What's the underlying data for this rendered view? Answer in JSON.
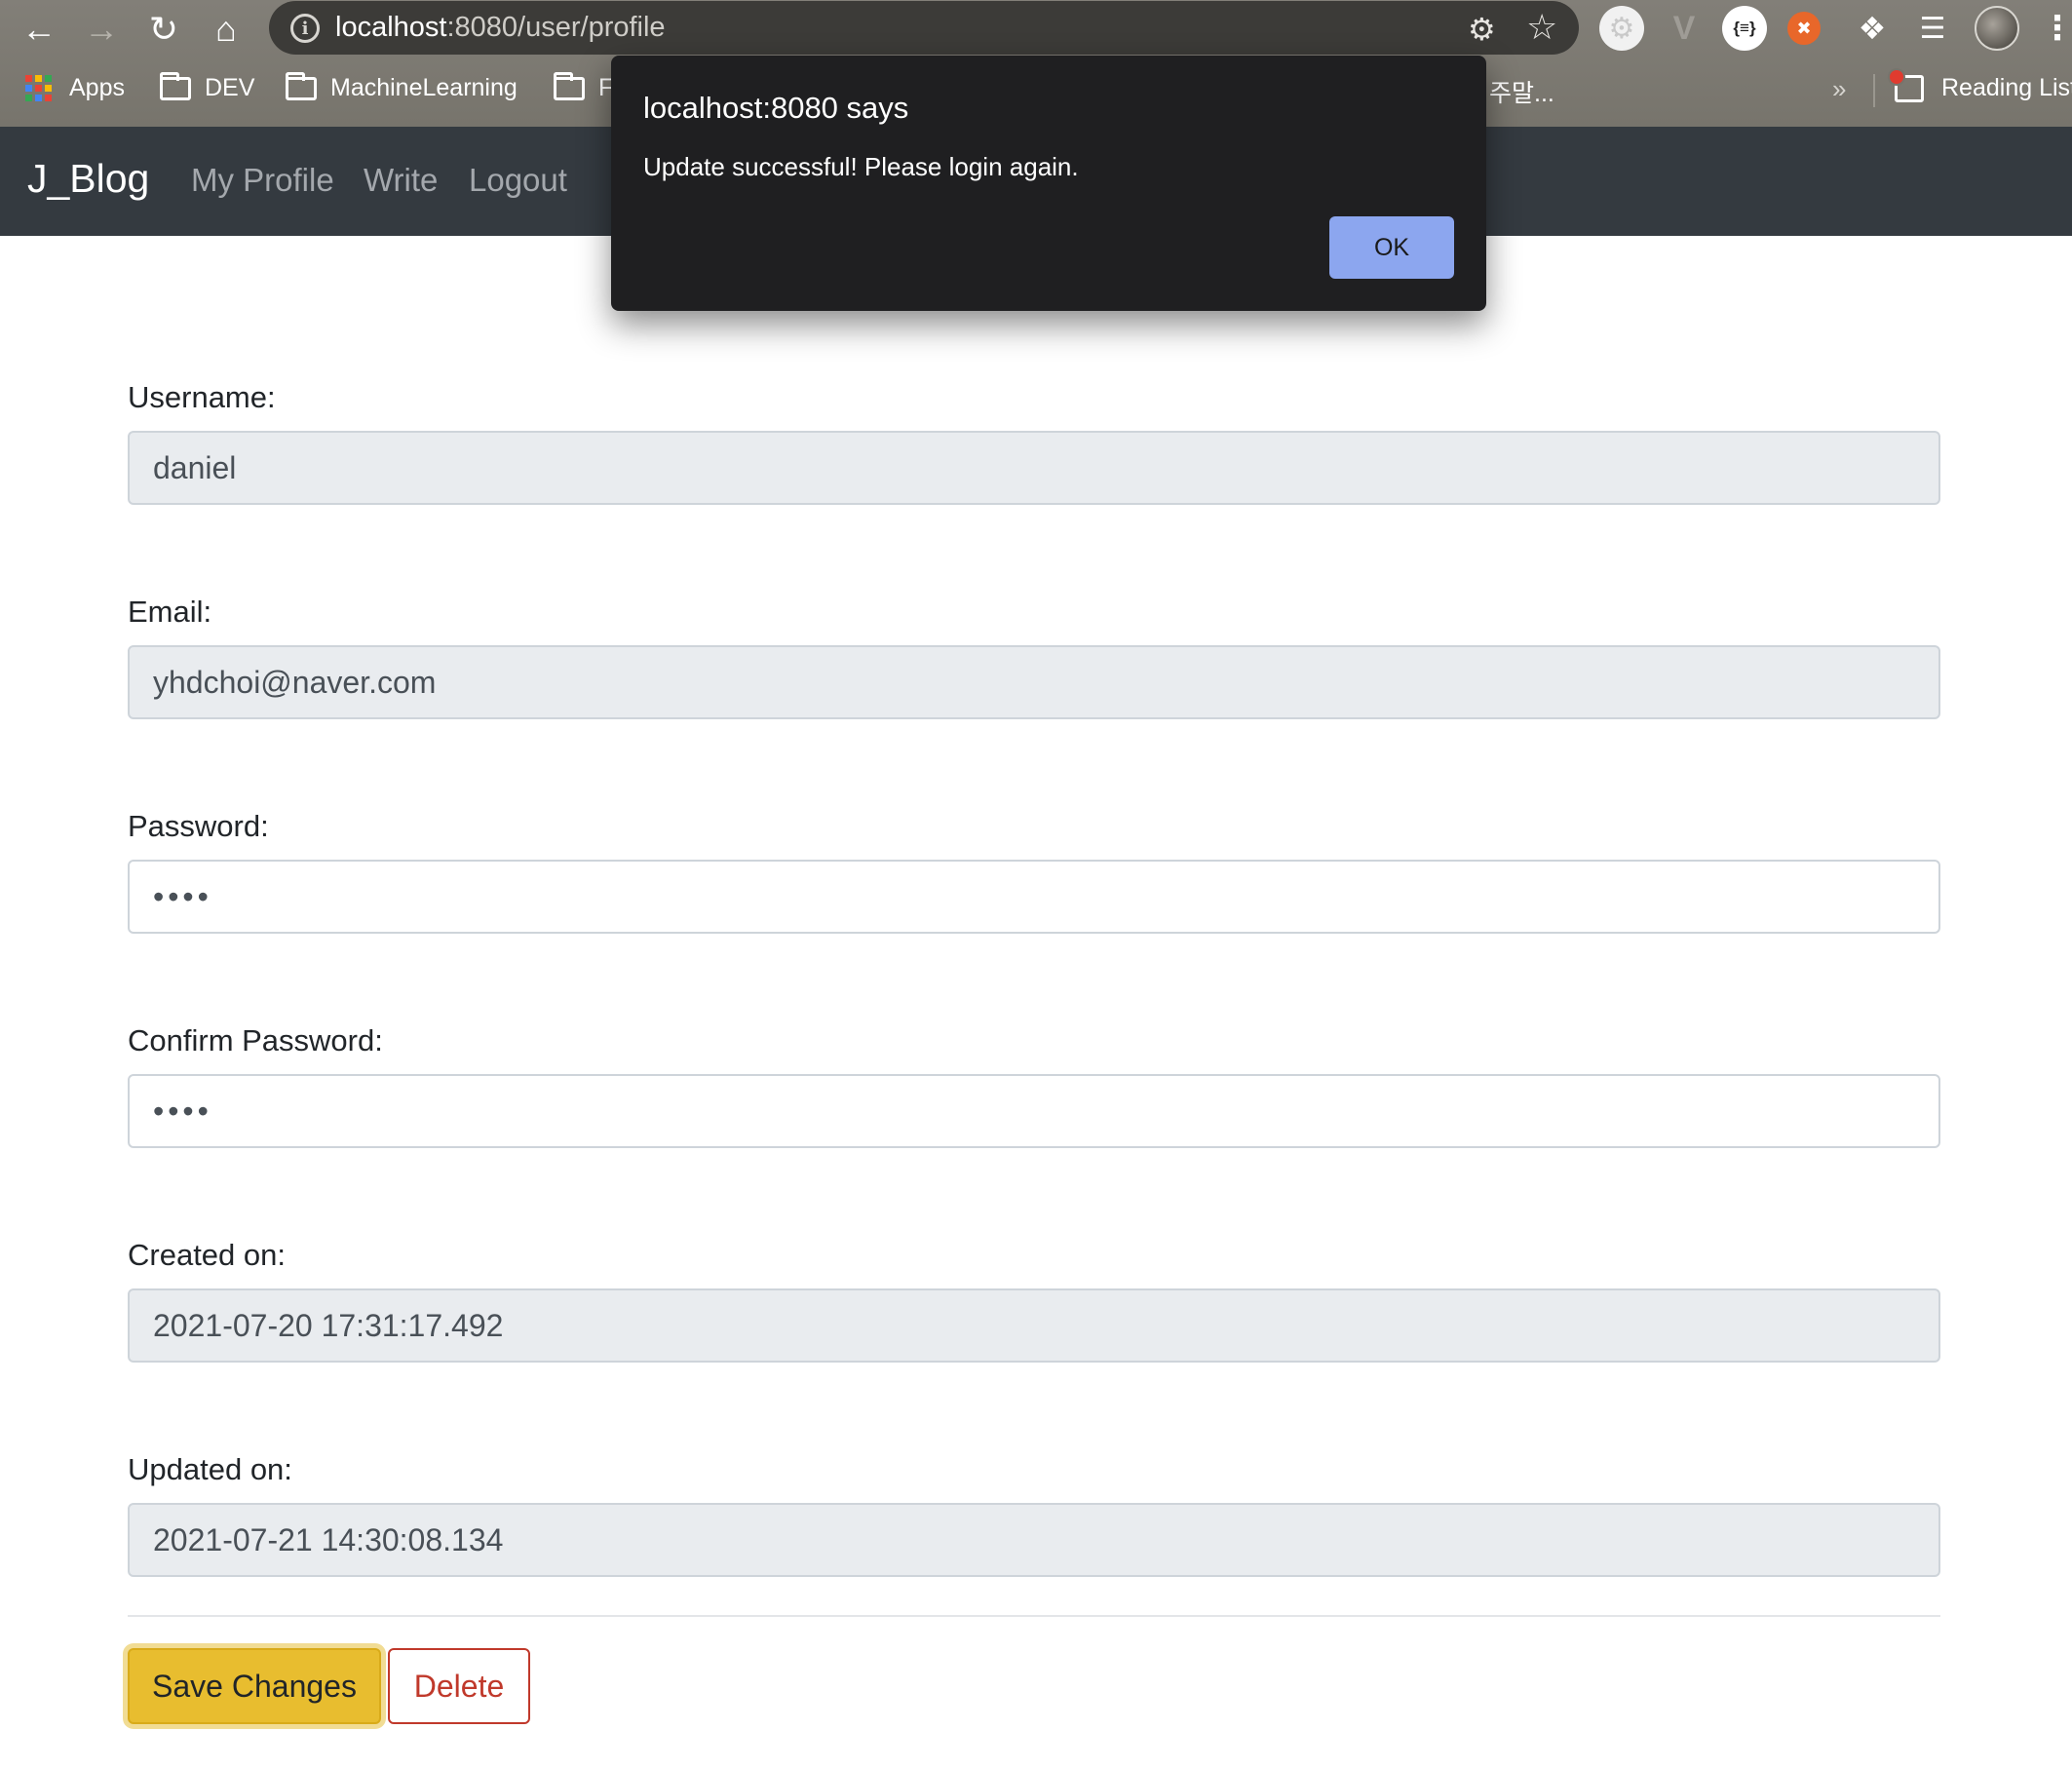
{
  "browser": {
    "url_host": "localhost",
    "url_path": ":8080/user/profile",
    "bookmarks": {
      "apps": "Apps",
      "dev": "DEV",
      "ml": "MachineLearning",
      "partial_folder": "F",
      "partial_korean": "주말...",
      "more": "»",
      "reading_list": "Reading List"
    },
    "icons": [
      "back-icon",
      "forward-icon",
      "reload-icon",
      "home-icon",
      "info-icon",
      "key-icon",
      "star-icon",
      "puzzle-icon",
      "media-icon",
      "menu-icon"
    ],
    "extension_json_label": "{≡}"
  },
  "navbar": {
    "brand": "J_Blog",
    "links": [
      "My Profile",
      "Write",
      "Logout"
    ],
    "bg_color": "#343a40"
  },
  "form": {
    "username": {
      "label": "Username:",
      "value": "daniel"
    },
    "email": {
      "label": "Email:",
      "value": "yhdchoi@naver.com"
    },
    "password": {
      "label": "Password:",
      "value": "1234"
    },
    "confirm_password": {
      "label": "Confirm Password:",
      "value": "1234"
    },
    "created_on": {
      "label": "Created on:",
      "value": "2021-07-20 17:31:17.492"
    },
    "updated_on": {
      "label": "Updated on:",
      "value": "2021-07-21 14:30:08.134"
    },
    "save_label": "Save Changes",
    "delete_label": "Delete",
    "save_color": "#e8bd2f",
    "delete_color": "#c0392b"
  },
  "dialog": {
    "title": "localhost:8080 says",
    "message": "Update successful! Please login again.",
    "ok_label": "OK",
    "ok_color": "#8ca6ef"
  }
}
